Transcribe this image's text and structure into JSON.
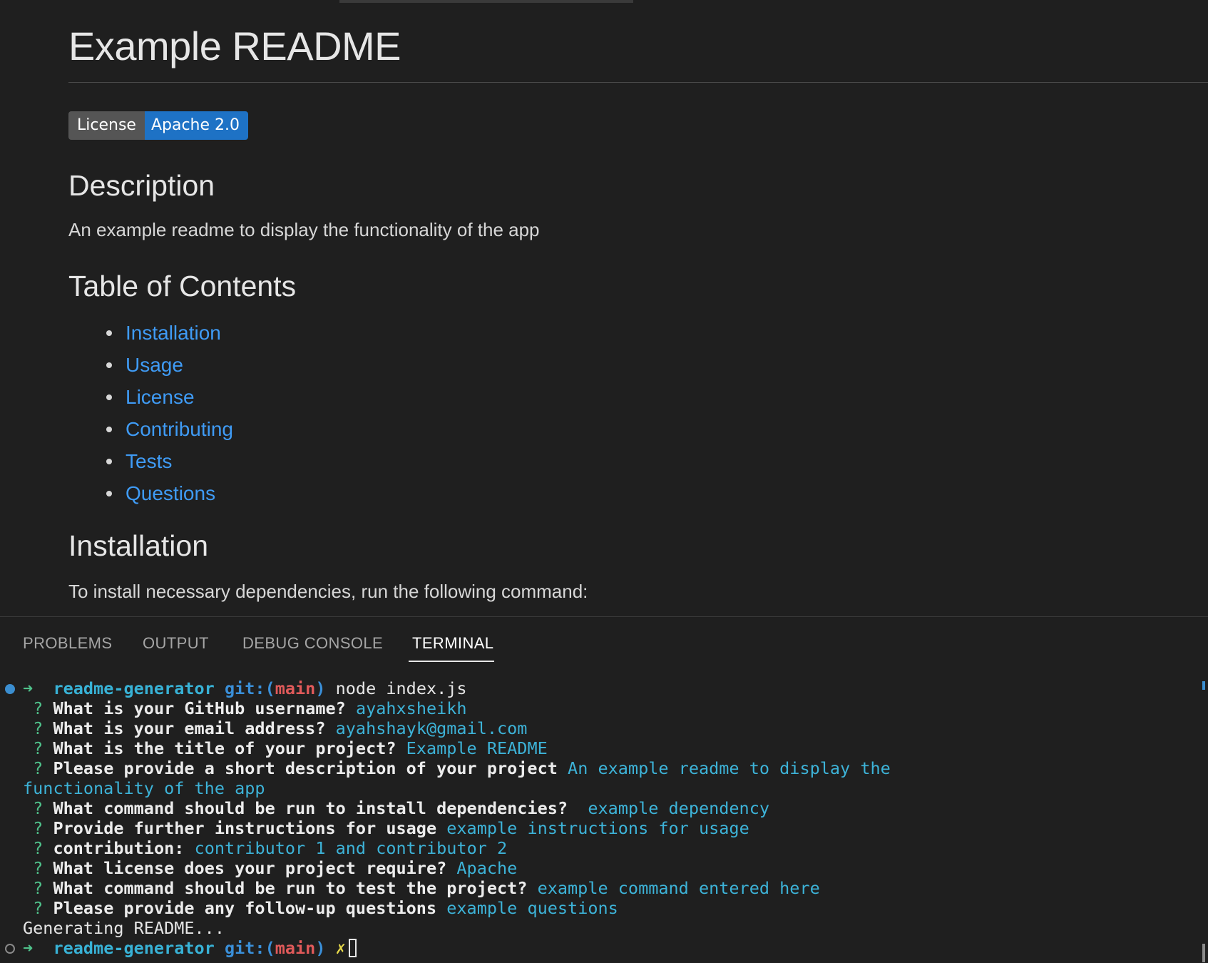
{
  "preview": {
    "title": "Example README",
    "badge": {
      "left": "License",
      "right": "Apache 2.0"
    },
    "sections": {
      "description_heading": "Description",
      "description_text": "An example readme to display the functionality of the app",
      "toc_heading": "Table of Contents",
      "installation_heading": "Installation",
      "installation_text": "To install necessary dependencies, run the following command:"
    },
    "toc": [
      "Installation",
      "Usage",
      "License",
      "Contributing",
      "Tests",
      "Questions"
    ]
  },
  "panel": {
    "tabs": [
      "PROBLEMS",
      "OUTPUT",
      "DEBUG CONSOLE",
      "TERMINAL"
    ],
    "active_tab": "TERMINAL"
  },
  "terminal": {
    "prompt": {
      "arrow": "➜",
      "dir": "readme-generator",
      "git_open": "git:(",
      "branch": "main",
      "git_close": ")",
      "command": "node index.js",
      "dirty_mark": "✗"
    },
    "qa": [
      {
        "mark": "?",
        "question": "What is your GitHub username?",
        "answer": "ayahxsheikh"
      },
      {
        "mark": "?",
        "question": "What is your email address?",
        "answer": "ayahshayk@gmail.com"
      },
      {
        "mark": "?",
        "question": "What is the title of your project?",
        "answer": "Example README"
      },
      {
        "mark": "?",
        "question": "Please provide a short description of your project",
        "answer": "An example readme to display the",
        "answer_cont": "functionality of the app"
      },
      {
        "mark": "?",
        "question": "What command should be run to install dependencies?",
        "answer": " example dependency"
      },
      {
        "mark": "?",
        "question": "Provide further instructions for usage",
        "answer": "example instructions for usage"
      },
      {
        "mark": "?",
        "question": "contribution:",
        "answer": "contributor 1 and contributor 2"
      },
      {
        "mark": "?",
        "question": "What license does your project require?",
        "answer": "Apache"
      },
      {
        "mark": "?",
        "question": "What command should be run to test the project?",
        "answer": "example command entered here"
      },
      {
        "mark": "?",
        "question": "Please provide any follow-up questions",
        "answer": "example questions"
      }
    ],
    "status": "Generating README..."
  },
  "colors": {
    "background": "#1f1f1f",
    "link": "#3f9bf5",
    "badge_right": "#1e72c5",
    "badge_left": "#555555",
    "answer": "#3db3d8",
    "question_mark": "#4fc18a",
    "branch": "#e15a5a"
  }
}
